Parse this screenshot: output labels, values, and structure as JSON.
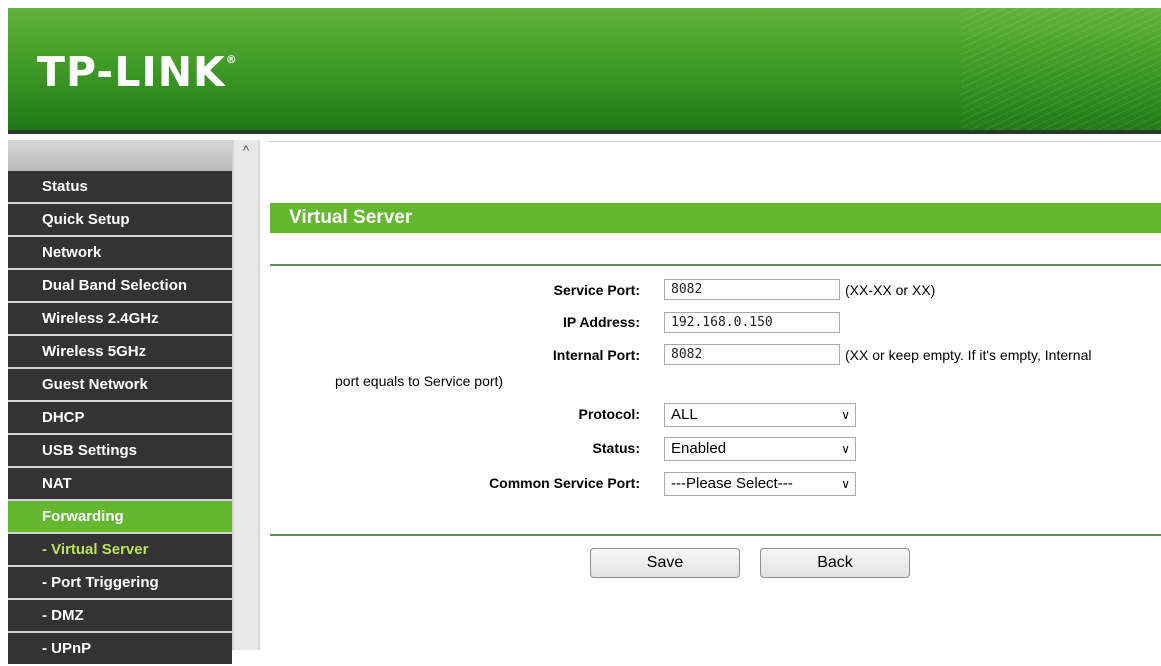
{
  "header": {
    "logo": "TP-LINK",
    "logo_mark": "®"
  },
  "sidebar": {
    "scroll_up": "^",
    "items": [
      {
        "label": "Status"
      },
      {
        "label": "Quick Setup"
      },
      {
        "label": "Network"
      },
      {
        "label": "Dual Band Selection"
      },
      {
        "label": "Wireless 2.4GHz"
      },
      {
        "label": "Wireless 5GHz"
      },
      {
        "label": "Guest Network"
      },
      {
        "label": "DHCP"
      },
      {
        "label": "USB Settings"
      },
      {
        "label": "NAT"
      },
      {
        "label": "Forwarding"
      },
      {
        "label": "- Virtual Server"
      },
      {
        "label": "- Port Triggering"
      },
      {
        "label": "- DMZ"
      },
      {
        "label": "- UPnP"
      }
    ]
  },
  "page": {
    "title": "Virtual Server",
    "service_port": {
      "label": "Service Port:",
      "value": "8082",
      "hint": "(XX-XX or XX)"
    },
    "ip_address": {
      "label": "IP Address:",
      "value": "192.168.0.150"
    },
    "internal_port": {
      "label": "Internal Port:",
      "value": "8082",
      "hint": "(XX or keep empty. If it's empty, Internal",
      "hint_cont": "port equals to Service port)"
    },
    "protocol": {
      "label": "Protocol:",
      "selected": "ALL"
    },
    "status": {
      "label": "Status:",
      "selected": "Enabled"
    },
    "common_service_port": {
      "label": "Common Service Port:",
      "selected": "---Please Select---"
    },
    "save_label": "Save",
    "back_label": "Back"
  },
  "colors": {
    "brand_green": "#64b82f",
    "menu_dark": "#333333",
    "submenu_active": "#b9e35a"
  }
}
